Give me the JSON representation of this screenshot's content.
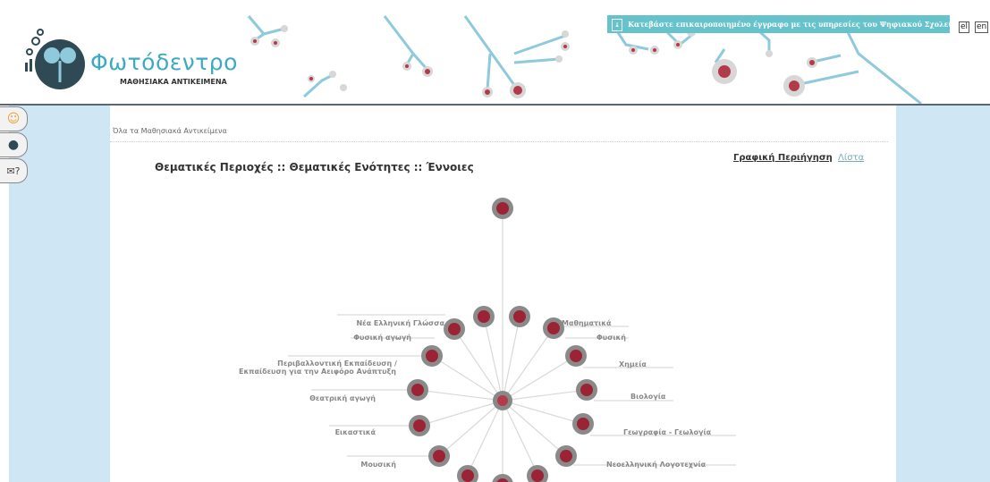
{
  "header": {
    "logo_title": "Φωτόδεντρο",
    "logo_subtitle": "ΜΑΘΗΣΙΑΚΑ ΑΝΤΙΚΕΙΜΕΝΑ",
    "notice": "Κατεβάστε επικαιροποιημένο έγγραφο με τις υπηρεσίες του Ψηφιακού Σχολείου",
    "lang_el": "el",
    "lang_en": "en"
  },
  "colors": {
    "accent": "#3fa9c4",
    "notice_bg": "#66c3cc",
    "side_bg": "#cfe6f5",
    "node_fill": "#9b2335"
  },
  "breadcrumb": "Όλα τα Μαθησιακά Αντικείμενα",
  "page_title": "Θεματικές Περιοχές :: Θεματικές Ενότητες :: Έννοιες",
  "view": {
    "graph_label": "Γραφική Περιήγηση",
    "list_label": "Λίστα"
  },
  "side_tabs": [
    "smiley-icon",
    "tree-icon",
    "mail-help-icon"
  ],
  "subjects": {
    "left": [
      "Νέα Ελληνική Γλώσσα",
      "Φυσική αγωγή",
      "Περιβαλλοντική Εκπαίδευση /",
      "Εκπαίδευση για την Αειφόρο Ανάπτυξη",
      "Θεατρική αγωγή",
      "Εικαστικά",
      "Μουσική"
    ],
    "right": [
      "Μαθηματικά",
      "Φυσική",
      "Χημεία",
      "Βιολογία",
      "Γεωγραφία - Γεωλογία",
      "Νεοελληνική Λογοτεχνία"
    ]
  }
}
